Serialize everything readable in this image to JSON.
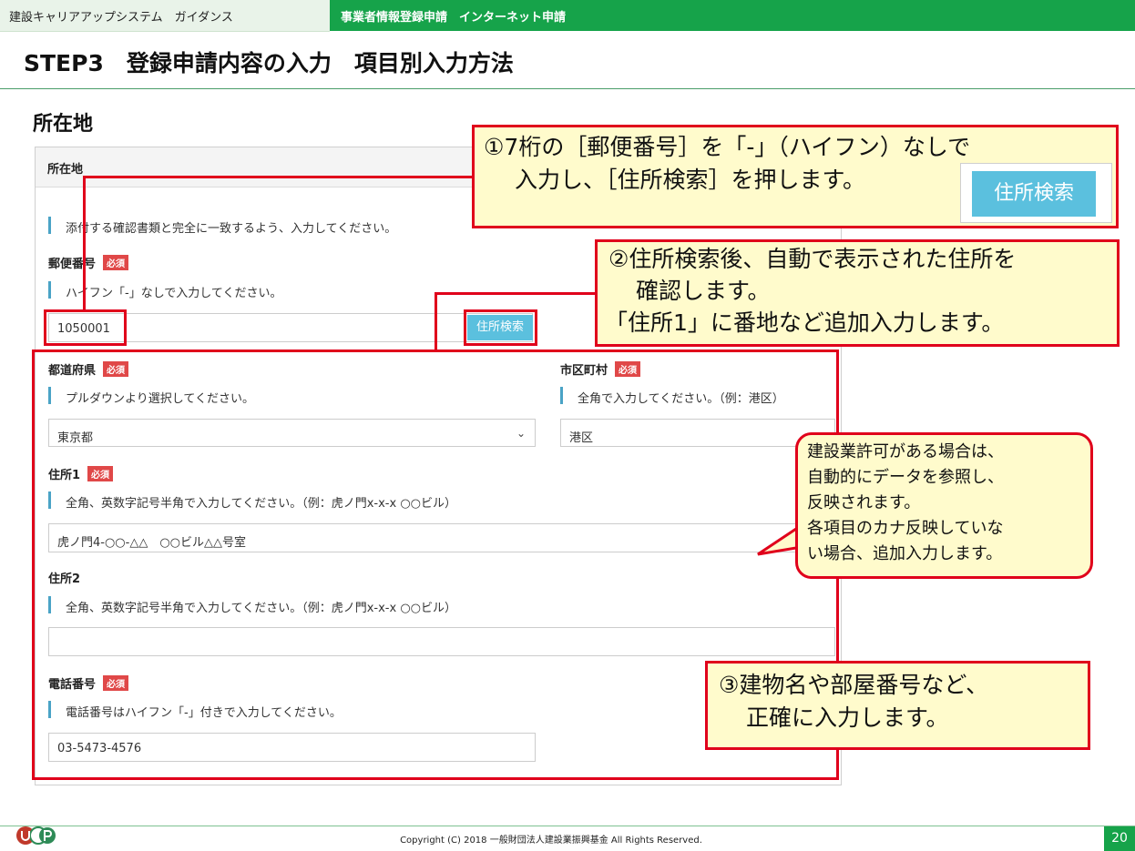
{
  "topbar": {
    "left_title": "建設キャリアアップシステム　ガイダンス",
    "right_title": "事業者情報登録申請　インターネット申請"
  },
  "step_title": "STEP3　登録申請内容の入力　項目別入力方法",
  "section_title": "所在地",
  "form": {
    "panel_header": "所在地",
    "top_hint": "添付する確認書類と完全に一致するよう、入力してください。",
    "required_badge": "必須",
    "postal": {
      "label": "郵便番号",
      "hint": "ハイフン「-」なしで入力してください。",
      "value": "1050001",
      "search_button": "住所検索"
    },
    "prefecture": {
      "label": "都道府県",
      "hint": "プルダウンより選択してください。",
      "selected": "東京都"
    },
    "city": {
      "label": "市区町村",
      "hint": "全角で入力してください。（例：港区）",
      "value": "港区"
    },
    "address1": {
      "label": "住所1",
      "hint": "全角、英数字記号半角で入力してください。（例：虎ノ門x-x-x ○○ビル）",
      "value": "虎ノ門4-○○-△△　○○ビル△△号室"
    },
    "address2": {
      "label": "住所2",
      "hint": "全角、英数字記号半角で入力してください。（例：虎ノ門x-x-x ○○ビル）",
      "value": ""
    },
    "phone": {
      "label": "電話番号",
      "hint": "電話番号はハイフン「-」付きで入力してください。",
      "value": "03-5473-4576"
    }
  },
  "callouts": {
    "c1": [
      "①7桁の［郵便番号］を「-」（ハイフン）なしで",
      "入力し、［住所検索］を押します。"
    ],
    "c1_button": "住所検索",
    "c2": [
      "②住所検索後、自動で表示された住所を",
      "確認します。",
      "「住所1」に番地など追加入力します。"
    ],
    "c3": [
      "③建物名や部屋番号など、",
      "正確に入力します。"
    ],
    "bubble": [
      "建設業許可がある場合は、",
      "自動的にデータを参照し、",
      "反映されます。",
      "各項目のカナ反映していな",
      "い場合、追加入力します。"
    ]
  },
  "footer": {
    "copyright": "Copyright (C) 2018 一般財団法人建設業振興基金 All Rights Reserved.",
    "page_number": "20"
  },
  "colors": {
    "brand_green": "#16a34a",
    "highlight_red": "#e0001b",
    "callout_yellow": "#fffbcc",
    "button_blue": "#5bc0de",
    "required_red": "#e04848"
  }
}
